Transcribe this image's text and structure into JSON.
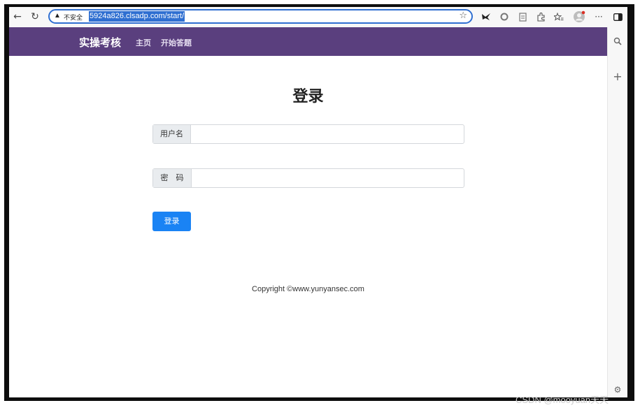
{
  "browser": {
    "back_icon": "←",
    "reload_icon": "↻",
    "insecure_label": "不安全",
    "url": "5924a826.clsadp.com/start/",
    "star_icon": "☆",
    "more_icon": "···",
    "side_search_icon": "🔍",
    "side_add_icon": "+",
    "side_settings_icon": "⚙"
  },
  "navbar": {
    "brand": "实操考核",
    "links": [
      "主页",
      "开始答题"
    ],
    "background": "#5a3f7e"
  },
  "login": {
    "title": "登录",
    "username_label": "用户名",
    "password_label": "密　码",
    "submit_label": "登录",
    "accent": "#1a83f4"
  },
  "footer": {
    "copyright": "Copyright ©www.yunyansec.com"
  },
  "watermark": "CSDN @mooyuan天天"
}
